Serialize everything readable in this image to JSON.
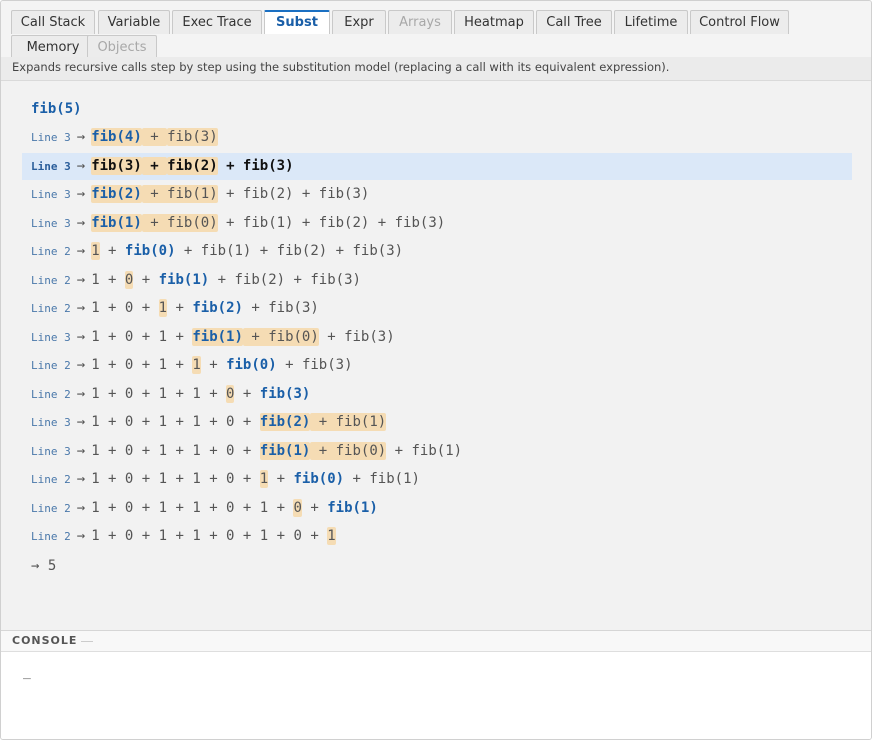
{
  "tabs": [
    {
      "label": "Call Stack",
      "state": "normal"
    },
    {
      "label": "Variable",
      "state": "normal"
    },
    {
      "label": "Exec Trace",
      "state": "normal"
    },
    {
      "label": "Subst",
      "state": "active"
    },
    {
      "label": "Expr",
      "state": "normal"
    },
    {
      "label": "Arrays",
      "state": "disabled"
    },
    {
      "label": "Heatmap",
      "state": "normal"
    },
    {
      "label": "Call Tree",
      "state": "normal"
    },
    {
      "label": "Lifetime",
      "state": "normal"
    },
    {
      "label": "Control Flow",
      "state": "normal"
    },
    {
      "label": "Memory",
      "state": "normal"
    },
    {
      "label": "Objects",
      "state": "disabled"
    }
  ],
  "description": "Expands recursive calls step by step using the substitution model (replacing a call with its equivalent expression).",
  "initial_expression": "fib(5)",
  "arrow": "→",
  "steps": [
    {
      "line": "Line 3",
      "current": false,
      "parts": [
        {
          "t": "fib(4)",
          "s": "hlcall"
        },
        {
          "t": " + ",
          "s": "hl"
        },
        {
          "t": "fib(3)",
          "s": "hl"
        }
      ]
    },
    {
      "line": "Line 3",
      "current": true,
      "parts": [
        {
          "t": "fib(3)",
          "s": "hlcall"
        },
        {
          "t": " + ",
          "s": "hl"
        },
        {
          "t": "fib(2)",
          "s": "hl"
        },
        {
          "t": " + fib(3)",
          "s": ""
        }
      ]
    },
    {
      "line": "Line 3",
      "current": false,
      "parts": [
        {
          "t": "fib(2)",
          "s": "hlcall"
        },
        {
          "t": " + fib(1)",
          "s": "hl"
        },
        {
          "t": " + fib(2) + fib(3)",
          "s": ""
        }
      ]
    },
    {
      "line": "Line 3",
      "current": false,
      "parts": [
        {
          "t": "fib(1)",
          "s": "hlcall"
        },
        {
          "t": " + fib(0)",
          "s": "hl"
        },
        {
          "t": " + fib(1) + fib(2) + fib(3)",
          "s": ""
        }
      ]
    },
    {
      "line": "Line 2",
      "current": false,
      "parts": [
        {
          "t": "1",
          "s": "hl"
        },
        {
          "t": " + ",
          "s": ""
        },
        {
          "t": "fib(0)",
          "s": "call"
        },
        {
          "t": " + fib(1) + fib(2) + fib(3)",
          "s": ""
        }
      ]
    },
    {
      "line": "Line 2",
      "current": false,
      "parts": [
        {
          "t": "1 + ",
          "s": ""
        },
        {
          "t": "0",
          "s": "hl"
        },
        {
          "t": " + ",
          "s": ""
        },
        {
          "t": "fib(1)",
          "s": "call"
        },
        {
          "t": " + fib(2) + fib(3)",
          "s": ""
        }
      ]
    },
    {
      "line": "Line 2",
      "current": false,
      "parts": [
        {
          "t": "1 + 0 + ",
          "s": ""
        },
        {
          "t": "1",
          "s": "hl"
        },
        {
          "t": " + ",
          "s": ""
        },
        {
          "t": "fib(2)",
          "s": "call"
        },
        {
          "t": " + fib(3)",
          "s": ""
        }
      ]
    },
    {
      "line": "Line 3",
      "current": false,
      "parts": [
        {
          "t": "1 + 0 + 1 + ",
          "s": ""
        },
        {
          "t": "fib(1)",
          "s": "hlcall"
        },
        {
          "t": " + fib(0)",
          "s": "hl"
        },
        {
          "t": " + fib(3)",
          "s": ""
        }
      ]
    },
    {
      "line": "Line 2",
      "current": false,
      "parts": [
        {
          "t": "1 + 0 + 1 + ",
          "s": ""
        },
        {
          "t": "1",
          "s": "hl"
        },
        {
          "t": " + ",
          "s": ""
        },
        {
          "t": "fib(0)",
          "s": "call"
        },
        {
          "t": " + fib(3)",
          "s": ""
        }
      ]
    },
    {
      "line": "Line 2",
      "current": false,
      "parts": [
        {
          "t": "1 + 0 + 1 + 1 + ",
          "s": ""
        },
        {
          "t": "0",
          "s": "hl"
        },
        {
          "t": " + ",
          "s": ""
        },
        {
          "t": "fib(3)",
          "s": "call"
        }
      ]
    },
    {
      "line": "Line 3",
      "current": false,
      "parts": [
        {
          "t": "1 + 0 + 1 + 1 + 0 + ",
          "s": ""
        },
        {
          "t": "fib(2)",
          "s": "hlcall"
        },
        {
          "t": " + fib(1)",
          "s": "hl"
        }
      ]
    },
    {
      "line": "Line 3",
      "current": false,
      "parts": [
        {
          "t": "1 + 0 + 1 + 1 + 0 + ",
          "s": ""
        },
        {
          "t": "fib(1)",
          "s": "hlcall"
        },
        {
          "t": " + fib(0)",
          "s": "hl"
        },
        {
          "t": " + fib(1)",
          "s": ""
        }
      ]
    },
    {
      "line": "Line 2",
      "current": false,
      "parts": [
        {
          "t": "1 + 0 + 1 + 1 + 0 + ",
          "s": ""
        },
        {
          "t": "1",
          "s": "hl"
        },
        {
          "t": " + ",
          "s": ""
        },
        {
          "t": "fib(0)",
          "s": "call"
        },
        {
          "t": " + fib(1)",
          "s": ""
        }
      ]
    },
    {
      "line": "Line 2",
      "current": false,
      "parts": [
        {
          "t": "1 + 0 + 1 + 1 + 0 + 1 + ",
          "s": ""
        },
        {
          "t": "0",
          "s": "hl"
        },
        {
          "t": " + ",
          "s": ""
        },
        {
          "t": "fib(1)",
          "s": "call"
        }
      ]
    },
    {
      "line": "Line 2",
      "current": false,
      "parts": [
        {
          "t": "1 + 0 + 1 + 1 + 0 + 1 + 0 + ",
          "s": ""
        },
        {
          "t": "1",
          "s": "hl"
        }
      ]
    }
  ],
  "result": "→ 5",
  "console": {
    "title": "CONSOLE",
    "cursor": "_"
  },
  "colors": {
    "accent": "#1a5fa8",
    "highlight": "#f5dcb4",
    "current_row": "#dbe8f8"
  }
}
